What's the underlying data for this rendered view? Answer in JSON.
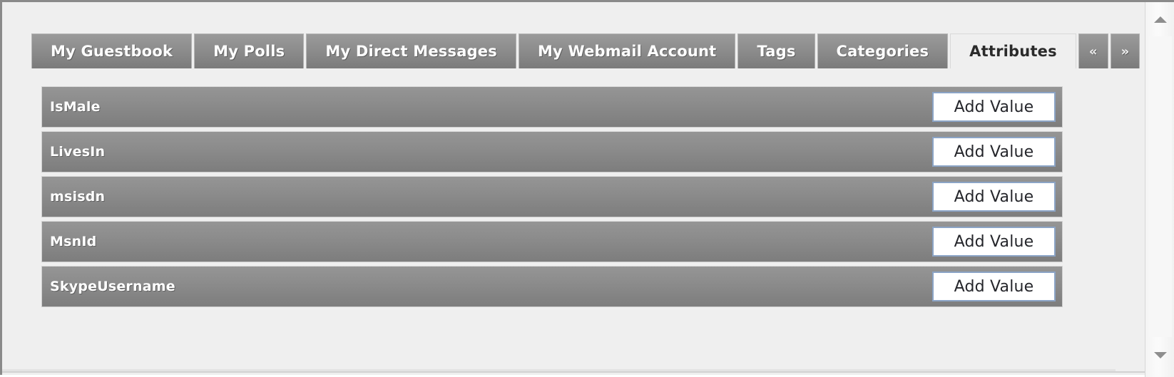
{
  "window": {
    "background_color": "#efefef",
    "border_color": "#8a8a8a"
  },
  "tabs": [
    {
      "label": "My Guestbook",
      "active": false,
      "name": "tab-my-guestbook"
    },
    {
      "label": "My Polls",
      "active": false,
      "name": "tab-my-polls"
    },
    {
      "label": "My Direct Messages",
      "active": false,
      "name": "tab-my-direct-messages"
    },
    {
      "label": "My Webmail Account",
      "active": false,
      "name": "tab-my-webmail-account"
    },
    {
      "label": "Tags",
      "active": false,
      "name": "tab-tags"
    },
    {
      "label": "Categories",
      "active": false,
      "name": "tab-categories"
    },
    {
      "label": "Attributes",
      "active": true,
      "name": "tab-attributes"
    }
  ],
  "tab_nav": {
    "prev_label": "«",
    "next_label": "»",
    "prev_icon": "double-chevron-left-icon",
    "next_icon": "double-chevron-right-icon"
  },
  "attributes": {
    "action_label": "Add Value",
    "rows": [
      {
        "name": "IsMale"
      },
      {
        "name": "LivesIn"
      },
      {
        "name": "msisdn"
      },
      {
        "name": "MsnId"
      },
      {
        "name": "SkypeUsername"
      }
    ]
  },
  "scrollbar": {
    "up_icon": "scroll-up-arrow-icon",
    "down_icon": "scroll-down-arrow-icon"
  },
  "colors": {
    "tab_inactive": "#8d8d8d",
    "tab_active": "#efefef",
    "row_gray": "#8c8c8c",
    "button_border": "#8ba4c6",
    "text_light": "#ffffff",
    "text_dark": "#25262b"
  }
}
